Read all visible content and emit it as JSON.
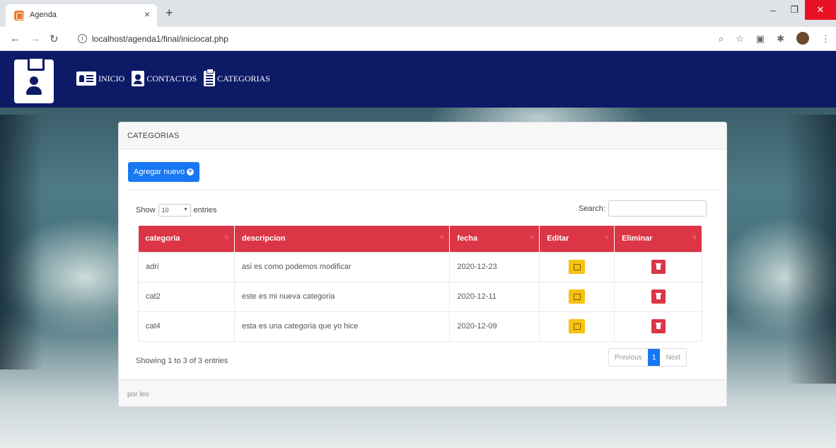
{
  "browser": {
    "tab_title": "Agenda",
    "tab_close": "×",
    "new_tab": "+",
    "url": "localhost/agenda1/final/iniciocat.php",
    "minimize": "–",
    "restore": "❐",
    "close": "✕"
  },
  "navbar": {
    "links": [
      {
        "label": "INICIO",
        "icon": "id-card-icon"
      },
      {
        "label": "CONTACTOS",
        "icon": "contact-book-icon"
      },
      {
        "label": "CATEGORIAS",
        "icon": "clipboard-list-icon"
      }
    ]
  },
  "card": {
    "header": "CATEGORIAS",
    "add_button": "Agregar nuevo",
    "footer": "por leo"
  },
  "table_controls": {
    "show_label": "Show",
    "entries_value": "10",
    "entries_label": "entries",
    "search_label": "Search:"
  },
  "table": {
    "columns": [
      "categoria",
      "descripcion",
      "fecha",
      "Editar",
      "Eliminar"
    ],
    "rows": [
      {
        "categoria": "adri",
        "descripcion": "asi es como podemos modificar",
        "fecha": "2020-12-23"
      },
      {
        "categoria": "cat2",
        "descripcion": "este es mi nueva categoria",
        "fecha": "2020-12-11"
      },
      {
        "categoria": "cat4",
        "descripcion": "esta es una categoria que yo hice",
        "fecha": "2020-12-09"
      }
    ]
  },
  "footer_info": {
    "showing": "Showing 1 to 3 of 3 entries",
    "previous": "Previous",
    "page": "1",
    "next": "Next"
  },
  "colors": {
    "navbar": "#0d1a66",
    "header_row": "#dc3545",
    "primary": "#1877f2",
    "edit": "#f7c20f"
  }
}
